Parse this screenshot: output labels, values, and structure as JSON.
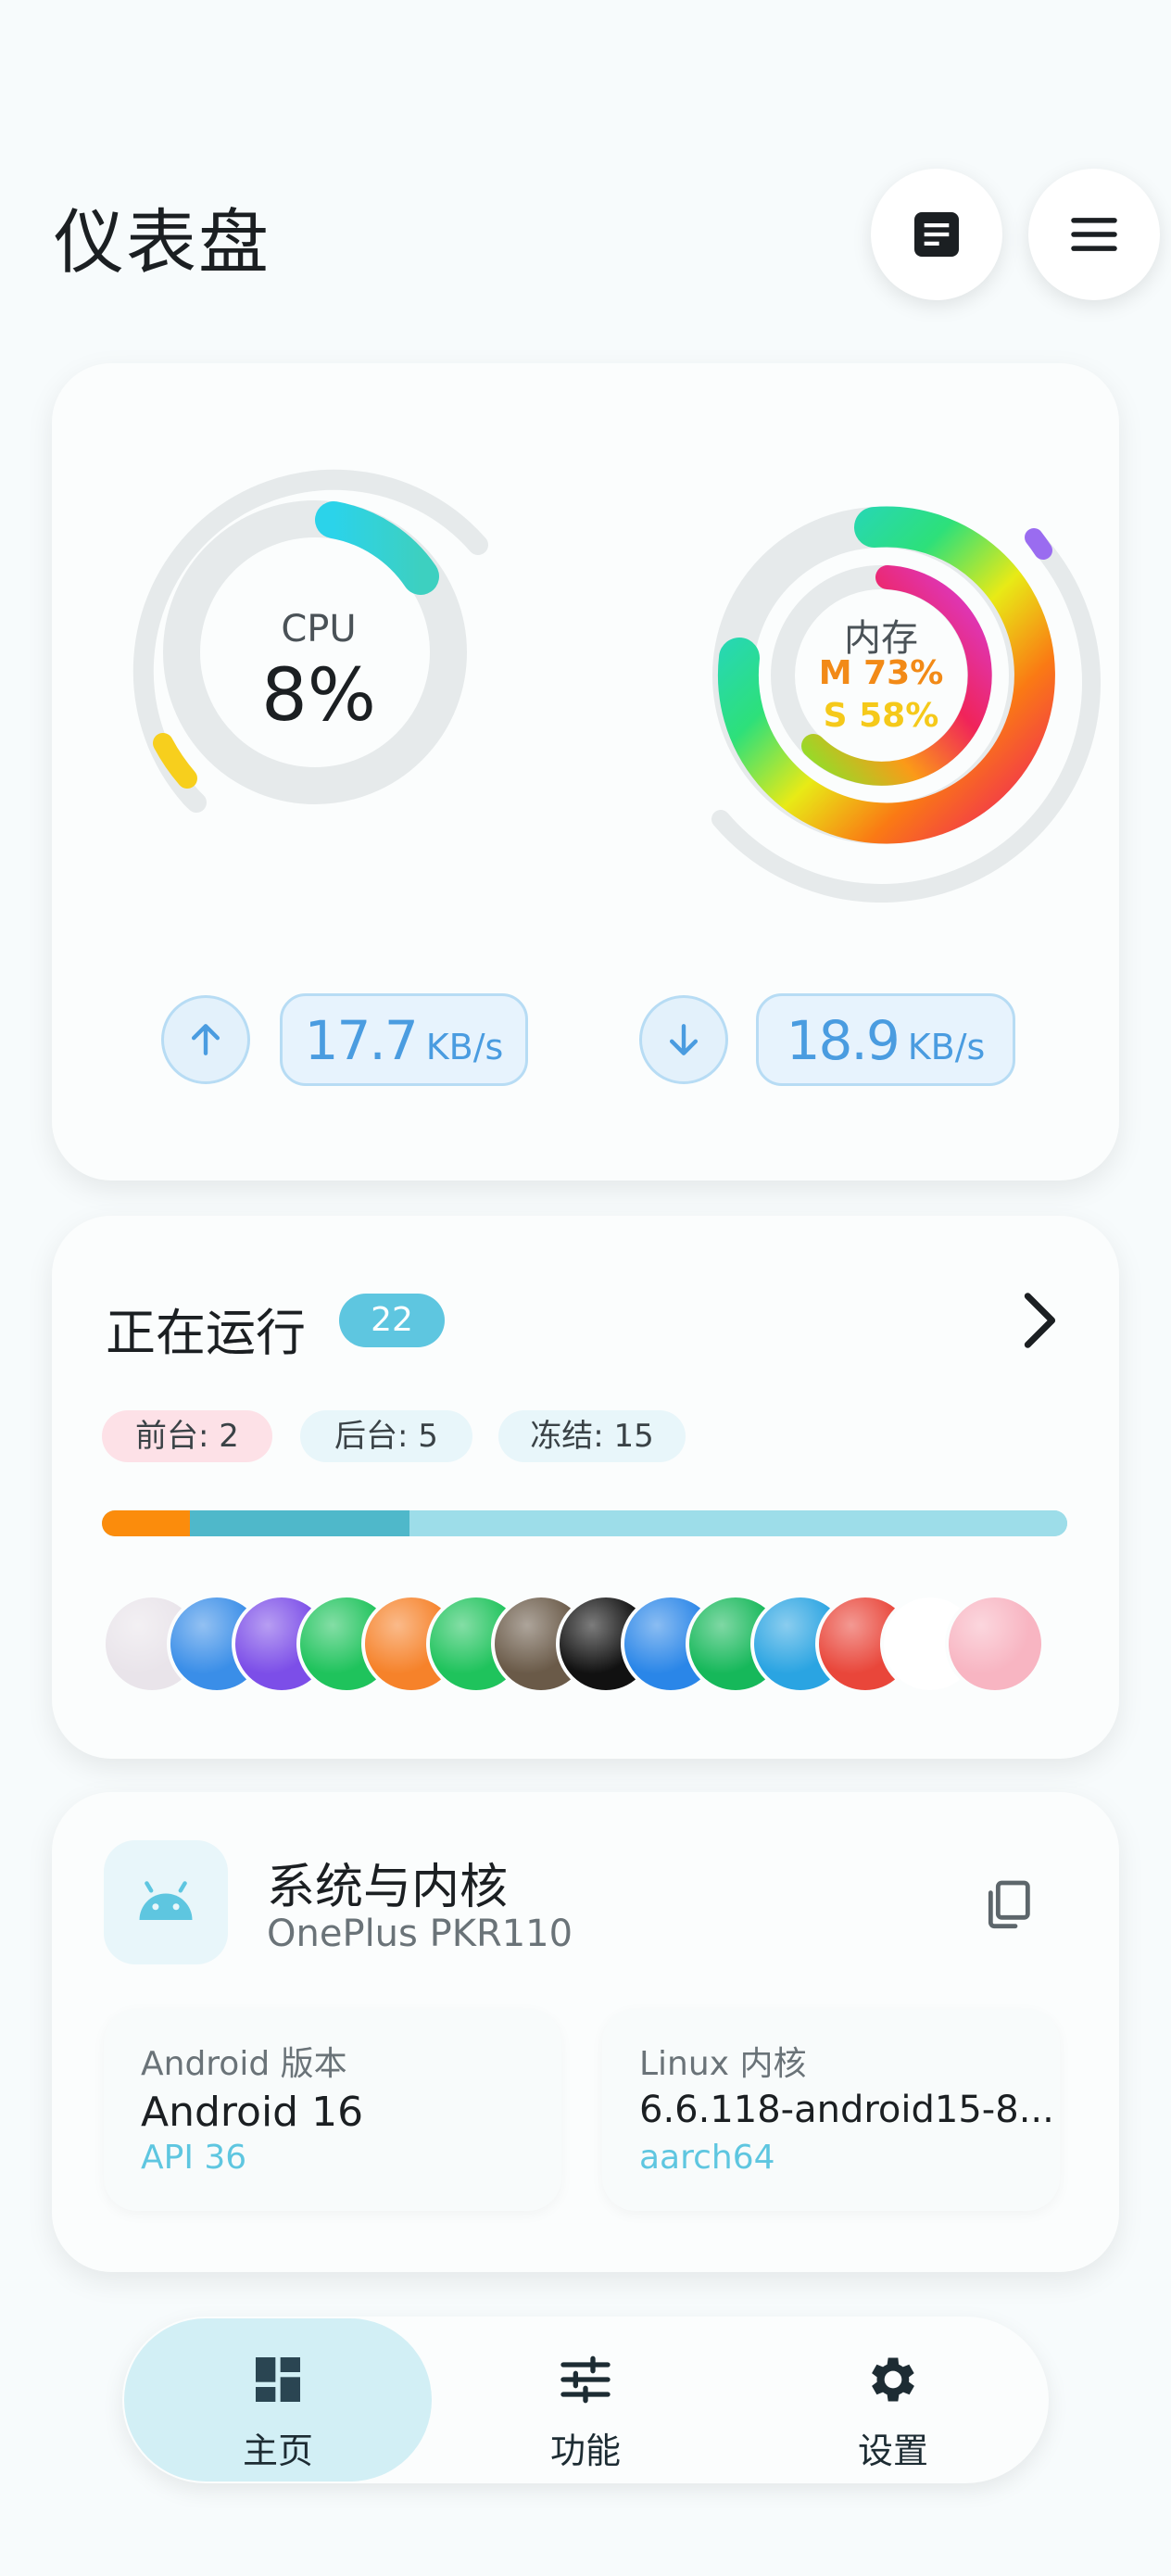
{
  "header": {
    "title": "仪表盘"
  },
  "gauges": {
    "cpu": {
      "label": "CPU",
      "value": "8%",
      "percent": 8,
      "accent": "#36c7e6"
    },
    "memory": {
      "label": "内存",
      "m_text": "M 73%",
      "s_text": "S 58%",
      "m_percent": 73,
      "s_percent": 58
    }
  },
  "network": {
    "upload": {
      "value": "17.7",
      "unit": "KB/s",
      "icon": "arrow-up-icon"
    },
    "download": {
      "value": "18.9",
      "unit": "KB/s",
      "icon": "arrow-down-icon"
    }
  },
  "running": {
    "title": "正在运行",
    "count": "22",
    "chips": {
      "foreground": "前台: 2",
      "background": "后台: 5",
      "frozen": "冻结: 15"
    },
    "distribution": {
      "foreground": 2,
      "background": 5,
      "frozen": 15
    },
    "apps": [
      {
        "name": "anime-app-icon",
        "color": "#e9e4ea"
      },
      {
        "name": "settings-app-icon",
        "color": "#3a8ee8"
      },
      {
        "name": "star-app-icon",
        "color": "#7c4ee8"
      },
      {
        "name": "wechat-app-icon",
        "color": "#1fc35c"
      },
      {
        "name": "video-app-icon",
        "color": "#f6822a"
      },
      {
        "name": "wechat-clone-app-icon",
        "color": "#1fc35c"
      },
      {
        "name": "game-app-icon",
        "color": "#6a5a48"
      },
      {
        "name": "tiktok-app-icon",
        "color": "#111111"
      },
      {
        "name": "bubble-app-icon",
        "color": "#2a86e8"
      },
      {
        "name": "link-app-icon",
        "color": "#16b85a"
      },
      {
        "name": "telegram-app-icon",
        "color": "#2aa4e2"
      },
      {
        "name": "chrome-app-icon",
        "color": "#e9463a"
      },
      {
        "name": "gemini-app-icon",
        "color": "#ffffff"
      },
      {
        "name": "pig-app-icon",
        "color": "#f8b5c2"
      }
    ]
  },
  "system": {
    "title": "系统与内核",
    "device": "OnePlus PKR110",
    "android": {
      "label": "Android 版本",
      "value": "Android 16",
      "sub": "API 36"
    },
    "linux": {
      "label": "Linux 内核",
      "value": "6.6.118-android15-8...",
      "sub": "aarch64"
    }
  },
  "nav": {
    "home": {
      "label": "主页",
      "icon": "dashboard-icon"
    },
    "features": {
      "label": "功能",
      "icon": "tune-icon"
    },
    "settings": {
      "label": "设置",
      "icon": "gear-icon"
    }
  }
}
